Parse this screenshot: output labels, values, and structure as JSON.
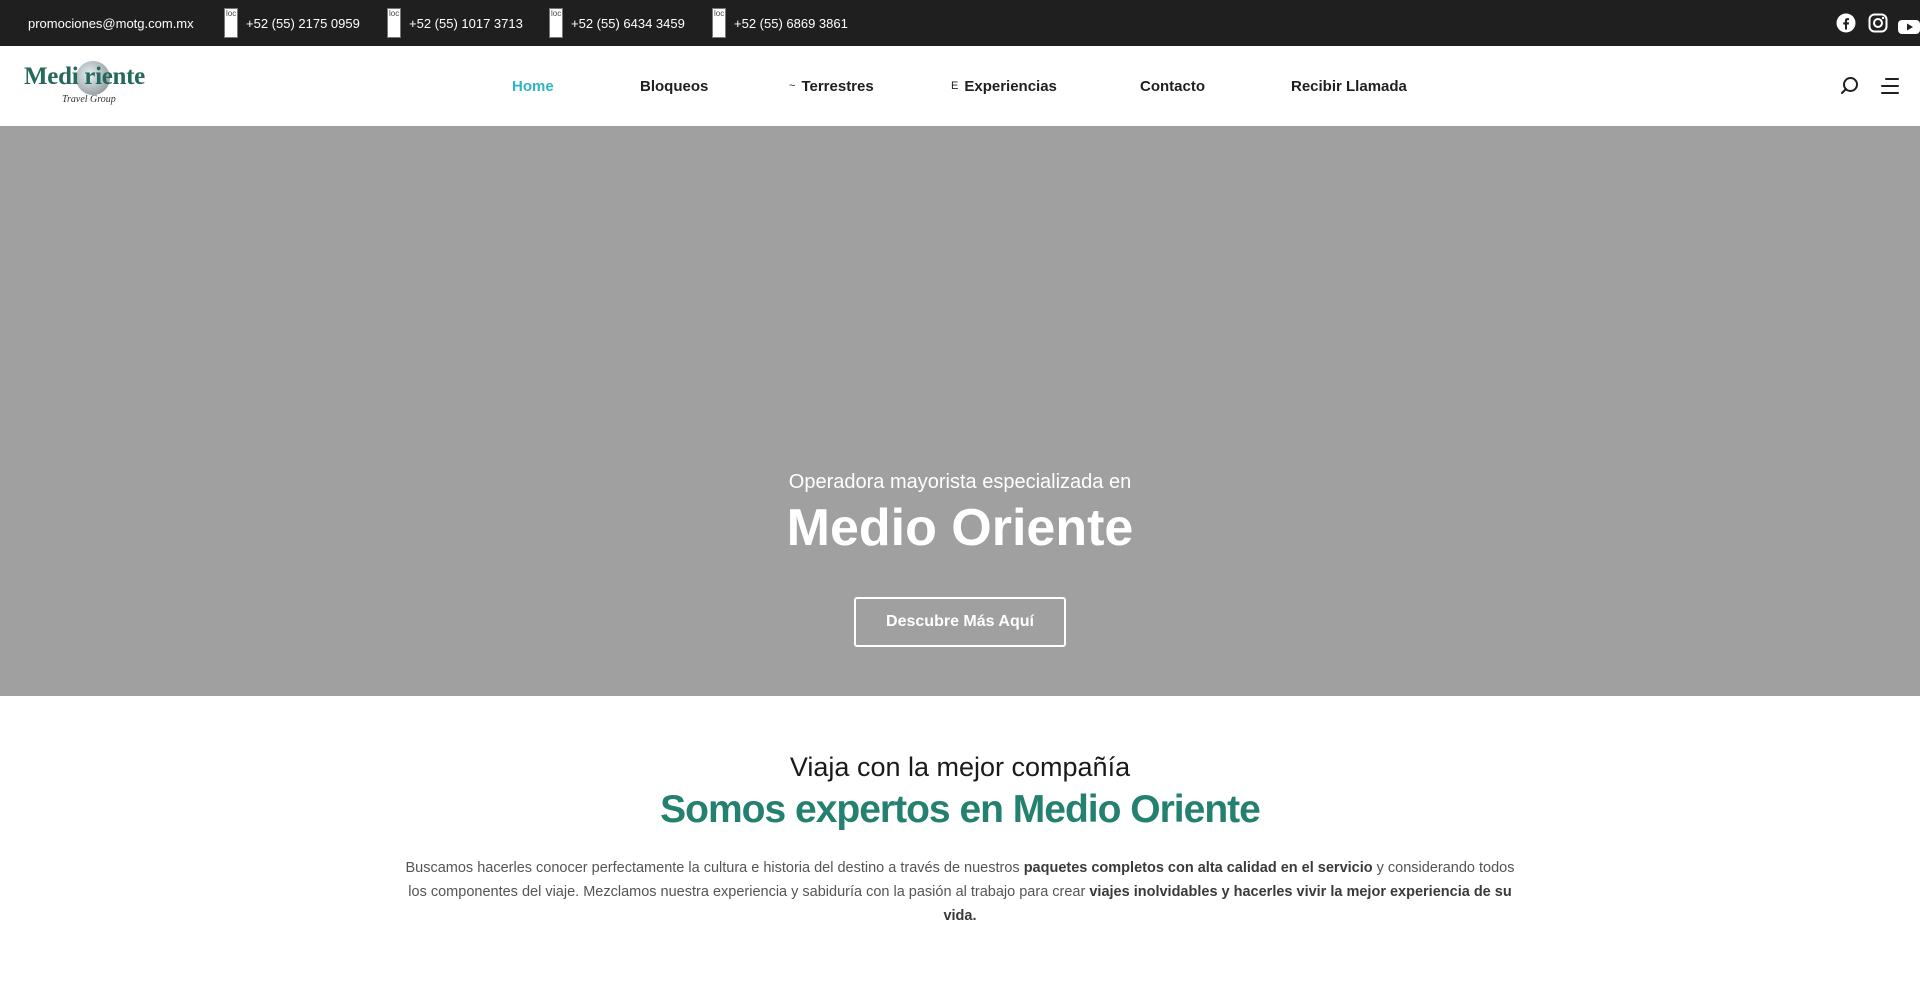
{
  "topbar": {
    "email": "promociones@motg.com.mx",
    "broken_img_alt": "loc",
    "phones": [
      "+52 (55) 2175 0959",
      "+52 (55) 1017 3713",
      "+52 (55) 6434 3459",
      "+52 (55) 6869 3861"
    ],
    "social": [
      "facebook-icon",
      "instagram-icon",
      "youtube-icon"
    ]
  },
  "header": {
    "logo": {
      "main": "Medi  riente",
      "sub": "Travel Group"
    },
    "nav": [
      {
        "label": "Home",
        "glyph": "",
        "active": true
      },
      {
        "label": "Bloqueos",
        "glyph": ""
      },
      {
        "label": "Terrestres",
        "glyph": "~"
      },
      {
        "label": "Experiencias",
        "glyph": "E"
      },
      {
        "label": "Contacto",
        "glyph": ""
      },
      {
        "label": "Recibir Llamada",
        "glyph": ""
      }
    ],
    "icons": [
      "search-icon",
      "menu-icon"
    ]
  },
  "hero": {
    "subtitle": "Operadora mayorista especializada en",
    "title": "Medio Oriente",
    "button": "Descubre Más Aquí"
  },
  "about": {
    "pretitle": "Viaja con la mejor compañía",
    "title": "Somos expertos en Medio Oriente",
    "p1": "Buscamos hacerles conocer perfectamente la cultura e historia del destino a través de nuestros ",
    "b1": "paquetes completos con alta calidad en el servicio",
    "p2": " y considerando todos los componentes del viaje. Mezclamos nuestra experiencia y sabiduría con la pasión al trabajo para crear ",
    "b2": "viajes inolvidables y hacerles vivir la mejor experiencia de su vida."
  },
  "colors": {
    "accent": "#2fb6c3",
    "brand": "#24806f",
    "topbar": "#1f1f1f",
    "hero": "#a0a0a0"
  }
}
